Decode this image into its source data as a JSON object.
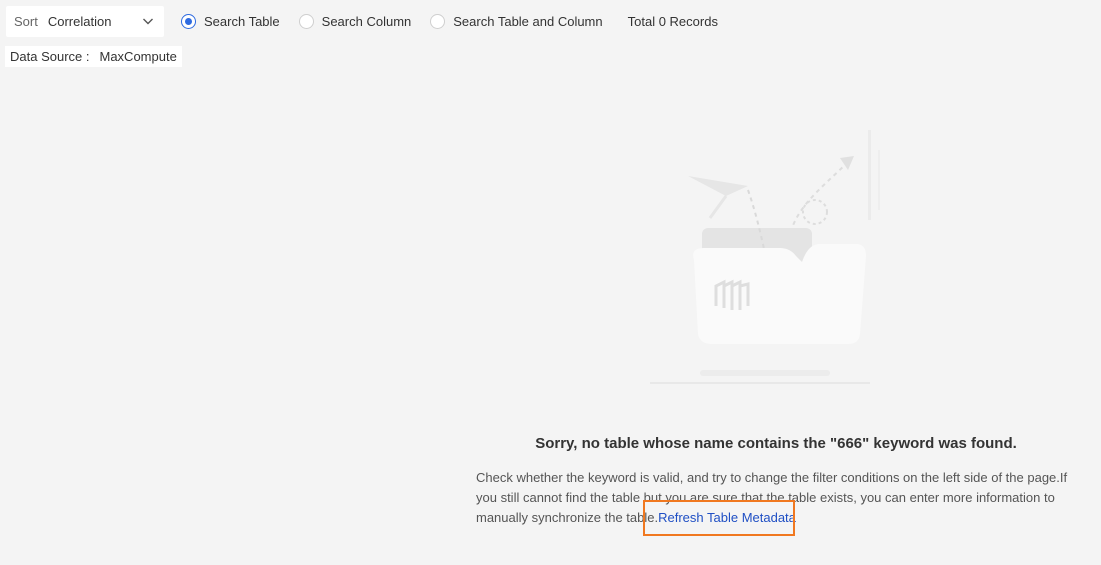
{
  "toolbar": {
    "sort_label": "Sort",
    "sort_value": "Correlation",
    "radios": [
      {
        "label": "Search Table",
        "checked": true
      },
      {
        "label": "Search Column",
        "checked": false
      },
      {
        "label": "Search Table and Column",
        "checked": false
      }
    ],
    "total": "Total 0 Records"
  },
  "datasource": {
    "label": "Data Source :",
    "value": "MaxCompute"
  },
  "empty": {
    "title": "Sorry, no table whose name contains the \"666\" keyword was found.",
    "description": "Check whether the keyword is valid, and try to change the filter conditions on the left side of the page.If you still cannot find the table but you are sure that the table exists, you can enter more information to manually synchronize the table.",
    "link": "Refresh Table Metadata"
  },
  "colors": {
    "accent": "#2d6ae0",
    "link": "#1f4fc4",
    "highlight": "#f07820",
    "background": "#f4f4f4"
  },
  "icons": {
    "sort_dropdown": "chevron-down-icon",
    "empty_state": "empty-folder-illustration"
  }
}
